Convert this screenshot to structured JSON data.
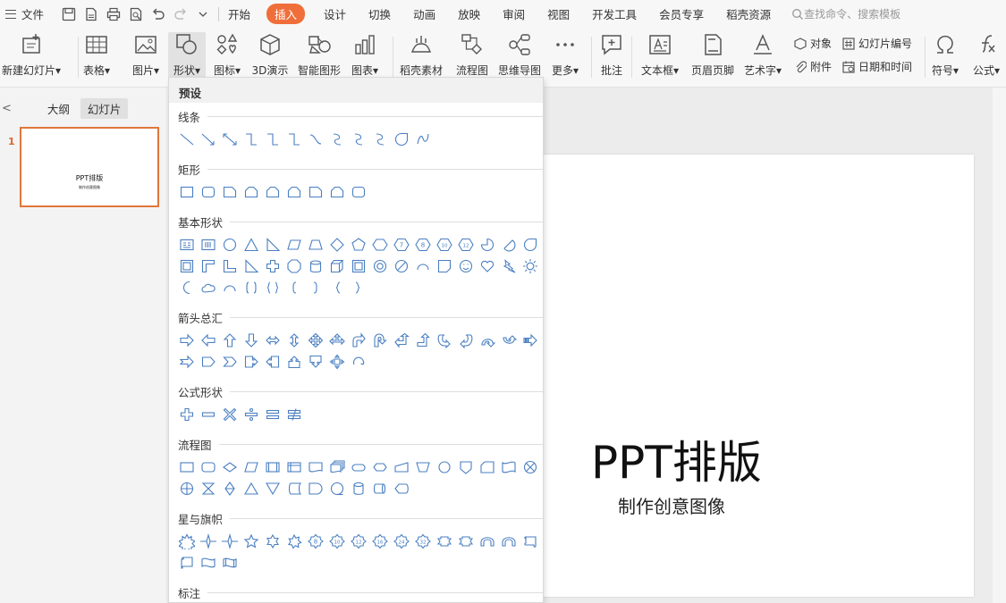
{
  "menubar": {
    "file_label": "文件",
    "tabs": [
      "开始",
      "插入",
      "设计",
      "切换",
      "动画",
      "放映",
      "审阅",
      "视图",
      "开发工具",
      "会员专享",
      "稻壳资源"
    ],
    "active_tab": "插入",
    "search_placeholder": "查找命令、搜索模板"
  },
  "ribbon": {
    "buttons": [
      {
        "label": "新建幻灯片",
        "dropdown": true,
        "icon": "new-slide-icon"
      },
      {
        "label": "表格",
        "dropdown": true,
        "icon": "table-icon"
      },
      {
        "label": "图片",
        "dropdown": true,
        "icon": "picture-icon"
      },
      {
        "label": "形状",
        "dropdown": true,
        "icon": "shapes-icon"
      },
      {
        "label": "图标",
        "dropdown": true,
        "icon": "icons-icon"
      },
      {
        "label": "3D演示",
        "dropdown": false,
        "icon": "cube-icon"
      },
      {
        "label": "智能图形",
        "dropdown": false,
        "icon": "smart-graphic-icon"
      },
      {
        "label": "图表",
        "dropdown": true,
        "icon": "chart-icon"
      },
      {
        "label": "稻壳素材",
        "dropdown": false,
        "icon": "material-icon"
      },
      {
        "label": "流程图",
        "dropdown": false,
        "icon": "flowchart-icon"
      },
      {
        "label": "思维导图",
        "dropdown": false,
        "icon": "mindmap-icon"
      },
      {
        "label": "更多",
        "dropdown": true,
        "icon": "more-icon"
      },
      {
        "label": "批注",
        "dropdown": false,
        "icon": "comment-icon"
      },
      {
        "label": "文本框",
        "dropdown": true,
        "icon": "textbox-icon"
      },
      {
        "label": "页眉页脚",
        "dropdown": false,
        "icon": "header-footer-icon"
      },
      {
        "label": "艺术字",
        "dropdown": true,
        "icon": "wordart-icon"
      },
      {
        "label": "符号",
        "dropdown": true,
        "icon": "omega-icon"
      },
      {
        "label": "公式",
        "dropdown": true,
        "icon": "formula-icon"
      }
    ],
    "small": {
      "object": "对象",
      "slide_number": "幻灯片编号",
      "attachment": "附件",
      "datetime": "日期和时间"
    }
  },
  "left_pane": {
    "tabs": [
      "大纲",
      "幻灯片"
    ],
    "active_tab": "幻灯片",
    "slide_number": "1",
    "thumb_title": "PPT排版",
    "thumb_subtitle": "制作创意图像"
  },
  "slide": {
    "title": "PPT排版",
    "subtitle": "制作创意图像"
  },
  "shapes_panel": {
    "header": "预设",
    "sections": [
      {
        "title": "线条",
        "count": 12
      },
      {
        "title": "矩形",
        "count": 9
      },
      {
        "title": "基本形状",
        "count": 43
      },
      {
        "title": "箭头总汇",
        "count": 27
      },
      {
        "title": "公式形状",
        "count": 6
      },
      {
        "title": "流程图",
        "count": 28
      },
      {
        "title": "星与旗帜",
        "count": 19
      },
      {
        "title": "标注",
        "count": 0
      }
    ]
  },
  "colors": {
    "accent": "#f06e3a",
    "shape_stroke": "#4a7fc1",
    "thumb_border": "#e0763b"
  }
}
